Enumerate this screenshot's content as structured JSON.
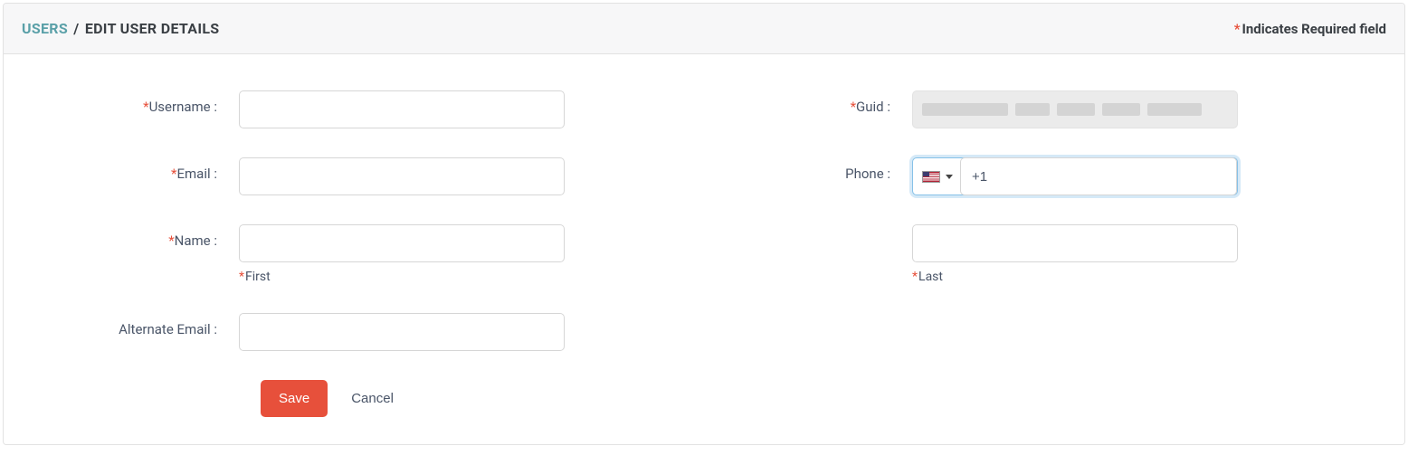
{
  "header": {
    "breadcrumb_parent": "USERS",
    "breadcrumb_sep": "/",
    "breadcrumb_current": "EDIT USER DETAILS",
    "required_note": "Indicates Required field"
  },
  "labels": {
    "username": "Username :",
    "email": "Email :",
    "name": "Name :",
    "alt_email": "Alternate Email :",
    "guid": "Guid :",
    "phone": "Phone :",
    "first": "First",
    "last": "Last"
  },
  "values": {
    "username": "",
    "email": "",
    "first_name": "",
    "last_name": "",
    "alt_email": "",
    "phone": "+1"
  },
  "buttons": {
    "save": "Save",
    "cancel": "Cancel"
  }
}
